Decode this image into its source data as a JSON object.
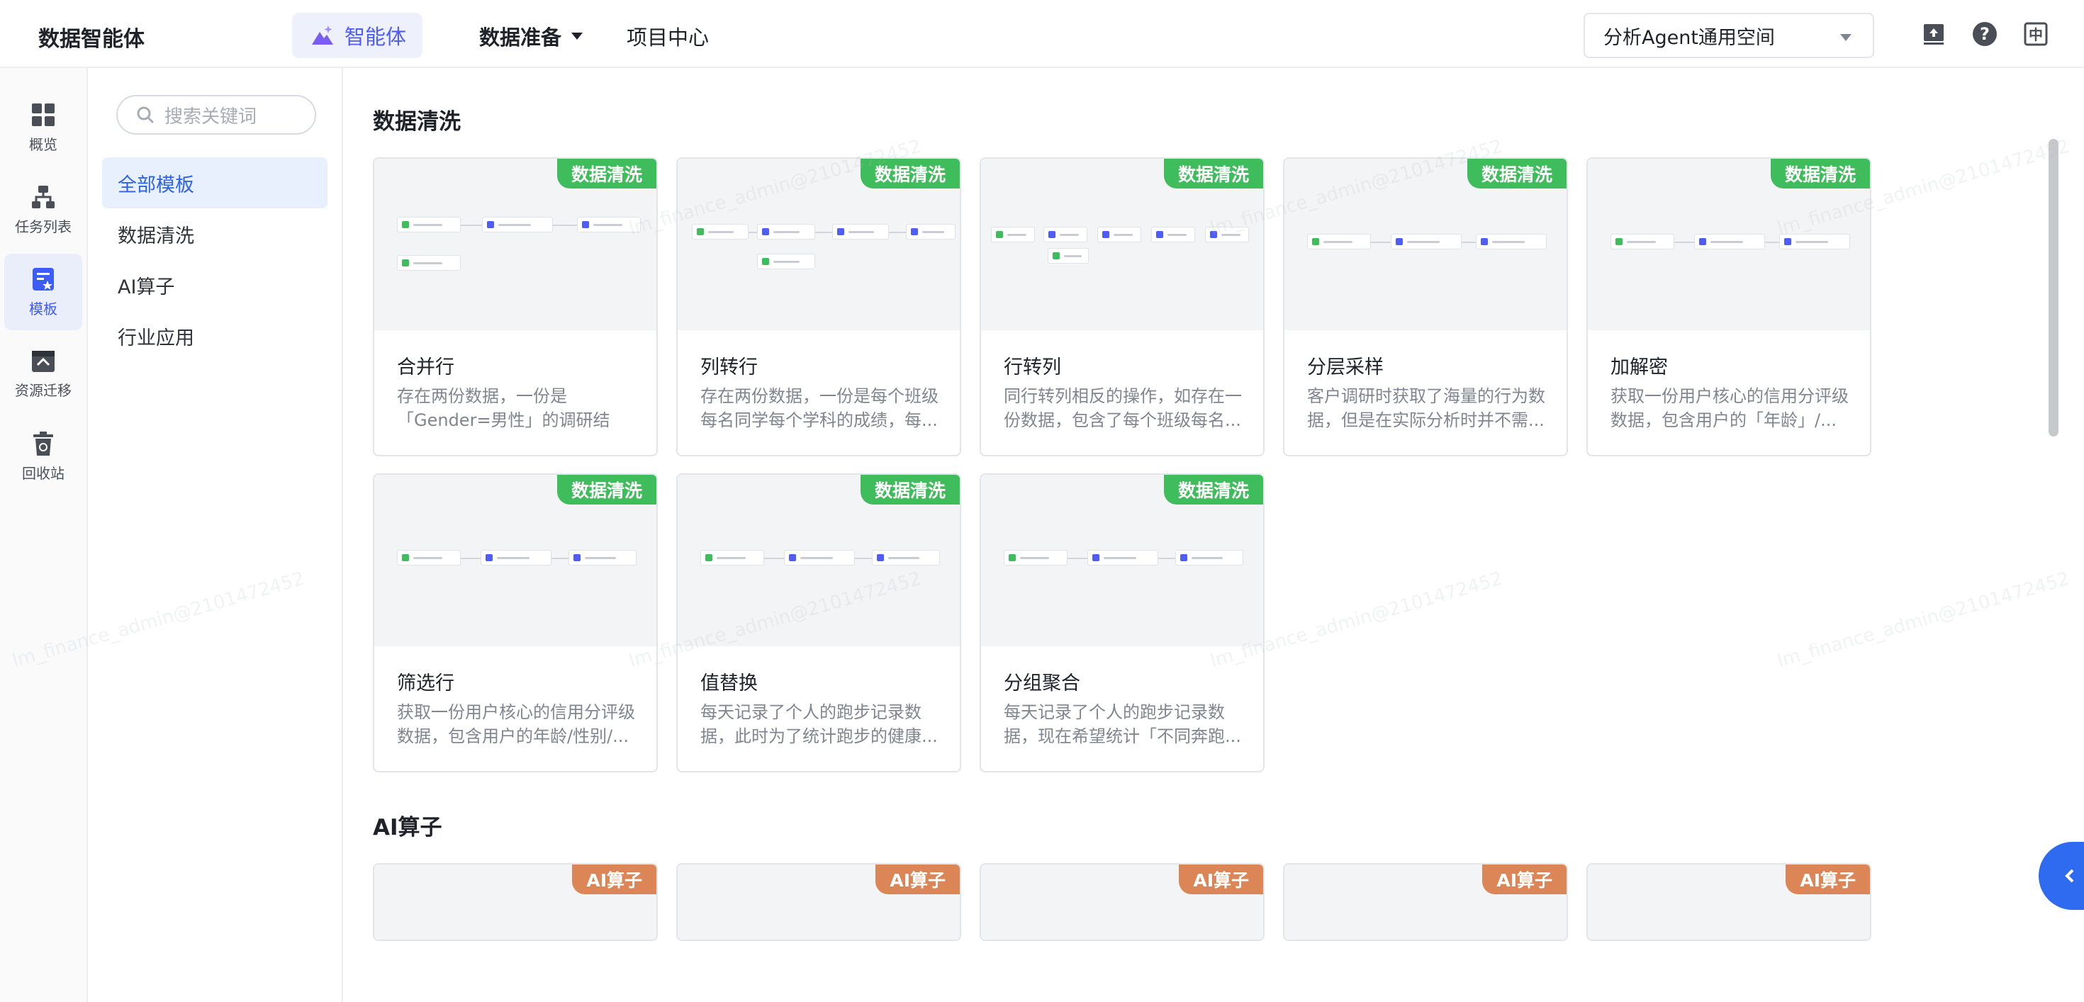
{
  "header": {
    "brand": "数据智能体",
    "nav_agent": "智能体",
    "nav_data": "数据准备",
    "nav_project": "项目中心",
    "workspace": "分析Agent通用空间",
    "icons": [
      "monitor-upload-icon",
      "help-icon",
      "language-icon"
    ],
    "language_glyph": "中"
  },
  "rail": {
    "items": [
      {
        "label": "概览",
        "icon": "grid-icon"
      },
      {
        "label": "任务列表",
        "icon": "hierarchy-icon"
      },
      {
        "label": "模板",
        "icon": "template-icon",
        "active": true
      },
      {
        "label": "资源迁移",
        "icon": "migrate-icon"
      },
      {
        "label": "回收站",
        "icon": "recycle-icon"
      }
    ]
  },
  "sidebar": {
    "search_placeholder": "搜索关键词",
    "categories": [
      {
        "label": "全部模板",
        "active": true
      },
      {
        "label": "数据清洗"
      },
      {
        "label": "AI算子"
      },
      {
        "label": "行业应用"
      }
    ]
  },
  "sections": [
    {
      "title": "数据清洗",
      "cards": [
        {
          "tag": "数据清洗",
          "title": "合并行",
          "desc": "存在两份数据，一份是「Gender=男性」的调研结果，一份是..."
        },
        {
          "tag": "数据清洗",
          "title": "列转行",
          "desc": "存在两份数据，一份是每个班级每名同学每个学科的成绩，每..."
        },
        {
          "tag": "数据清洗",
          "title": "行转列",
          "desc": "同行转列相反的操作，如存在一份数据，包含了每个班级每名..."
        },
        {
          "tag": "数据清洗",
          "title": "分层采样",
          "desc": "客户调研时获取了海量的行为数据，但是在实际分析时并不需..."
        },
        {
          "tag": "数据清洗",
          "title": "加解密",
          "desc": "获取一份用户核心的信用分评级数据，包含用户的「年龄」/..."
        },
        {
          "tag": "数据清洗",
          "title": "筛选行",
          "desc": "获取一份用户核心的信用分评级数据，包含用户的年龄/性别/..."
        },
        {
          "tag": "数据清洗",
          "title": "值替换",
          "desc": "每天记录了个人的跑步记录数据，此时为了统计跑步的健康..."
        },
        {
          "tag": "数据清洗",
          "title": "分组聚合",
          "desc": "每天记录了个人的跑步记录数据，现在希望统计「不同奔跑..."
        }
      ]
    },
    {
      "title": "AI算子",
      "cards": [
        {
          "tag": "AI算子"
        },
        {
          "tag": "AI算子"
        },
        {
          "tag": "AI算子"
        },
        {
          "tag": "AI算子"
        },
        {
          "tag": "AI算子"
        }
      ]
    }
  ],
  "watermark": "lm_finance_admin@2101472452",
  "colors": {
    "accent": "#4e5df6",
    "tag_green": "#3fbc5b",
    "tag_orange": "#dc8557",
    "active_bg": "#e8f0fd"
  }
}
